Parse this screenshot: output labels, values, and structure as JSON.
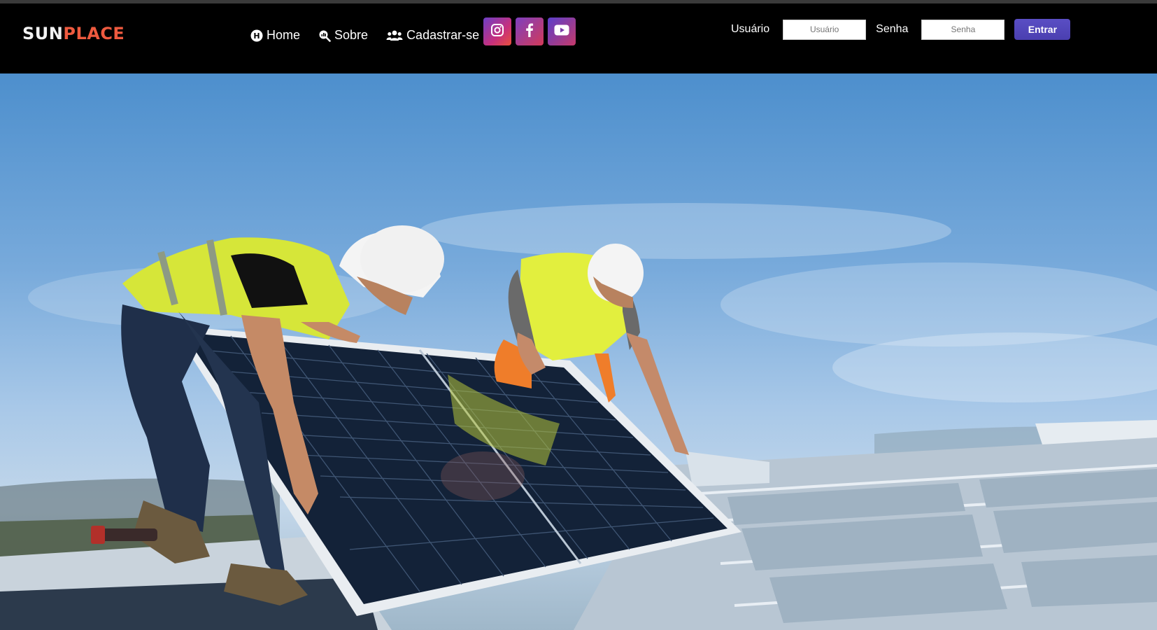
{
  "brand": {
    "part1": "SUN",
    "part2": "PLACE",
    "accent_color": "#ee5a3f"
  },
  "nav": {
    "items": [
      {
        "label": "Home",
        "icon": "home-circle-icon"
      },
      {
        "label": "Sobre",
        "icon": "search-chart-icon"
      },
      {
        "label": "Cadastrar-se",
        "icon": "users-icon"
      }
    ]
  },
  "social": [
    {
      "name": "instagram",
      "icon": "instagram-icon"
    },
    {
      "name": "facebook",
      "icon": "facebook-icon"
    },
    {
      "name": "youtube",
      "icon": "youtube-icon"
    }
  ],
  "login": {
    "user_label": "Usuário",
    "user_placeholder": "Usuário",
    "pass_label": "Senha",
    "pass_placeholder": "Senha",
    "submit_label": "Entrar",
    "button_color": "#4f44b8"
  },
  "hero": {
    "image": "workers-installing-solar-panel-photo"
  }
}
